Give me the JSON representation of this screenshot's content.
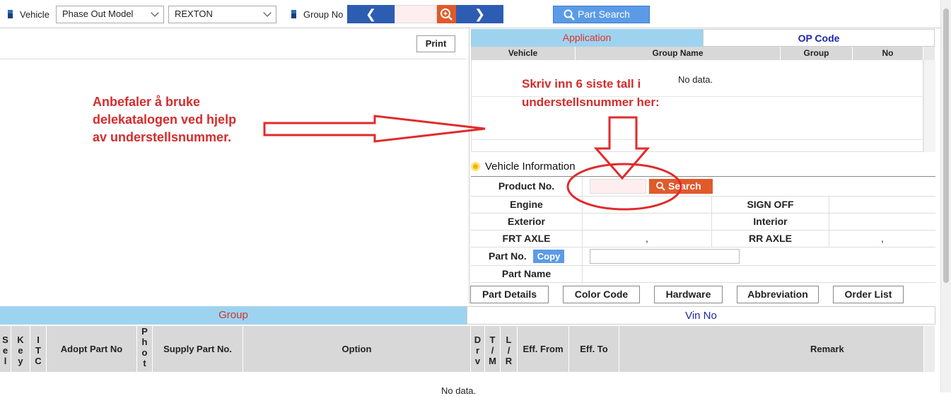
{
  "topbar": {
    "vehicle_label": "Vehicle",
    "model_select": "Phase Out Model",
    "vehicle_select": "REXTON",
    "group_no_label": "Group No",
    "prev_arrow": "❮",
    "next_arrow": "❯",
    "part_search_label": "Part Search"
  },
  "left": {
    "print_label": "Print",
    "annotation_lines": [
      "Anbefaler å bruke",
      "delekatalogen ved hjelp",
      "av understellsnummer."
    ]
  },
  "right": {
    "tab_application": "Application",
    "tab_op_code": "OP Code",
    "grid_headers": [
      "Vehicle",
      "Group Name",
      "Group",
      "No"
    ],
    "no_data": "No data.",
    "annotation_lines": [
      "Skriv inn 6 siste tall i",
      "understellsnummer her:"
    ],
    "vehicle_info_title": "Vehicle Information",
    "product_no_label": "Product No.",
    "search_label": "Search",
    "engine_label": "Engine",
    "sign_off_label": "SIGN OFF",
    "exterior_label": "Exterior",
    "interior_label": "Interior",
    "frt_axle_label": "FRT AXLE",
    "rr_axle_label": "RR AXLE",
    "frt_axle_value": ",",
    "rr_axle_value": ",",
    "part_no_label": "Part No.",
    "copy_label": "Copy",
    "part_name_label": "Part Name",
    "buttons": [
      "Part Details",
      "Color Code",
      "Hardware",
      "Abbreviation",
      "Order List"
    ]
  },
  "bottom": {
    "group_tab": "Group",
    "vin_tab": "Vin No",
    "headers": {
      "sel": "Sel",
      "key": "Key",
      "itc": "ITC",
      "adopt": "Adopt Part No",
      "photo": "Photo",
      "supply": "Supply Part No.",
      "option": "Option",
      "drv": "Drv",
      "tm": "T/M",
      "lr": "L/R",
      "eff_from": "Eff. From",
      "eff_to": "Eff. To",
      "remark": "Remark"
    },
    "no_data": "No data."
  },
  "colors": {
    "accent_blue": "#2d5db2",
    "tab_blue": "#9ed3ef",
    "search_orange": "#e05a2a",
    "annotation_red": "#d42c2c"
  }
}
